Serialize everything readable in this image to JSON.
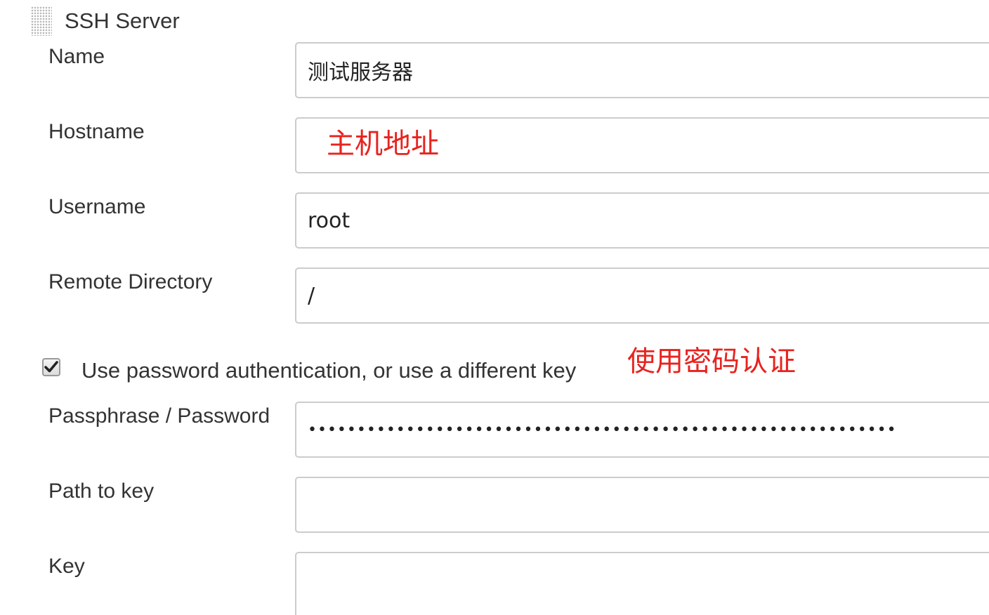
{
  "section": {
    "title": "SSH Server"
  },
  "fields": {
    "name": {
      "label": "Name",
      "value": "测试服务器"
    },
    "hostname": {
      "label": "Hostname",
      "value": "",
      "annotation": "主机地址"
    },
    "username": {
      "label": "Username",
      "value": "root"
    },
    "remote_directory": {
      "label": "Remote Directory",
      "value": "/"
    },
    "use_password": {
      "label": "Use password authentication, or use a different key",
      "checked": true,
      "annotation": "使用密码认证"
    },
    "passphrase": {
      "label": "Passphrase / Password",
      "value": "••••••••••••••••••••••••••••••••••••••••••••••••••••••••••••"
    },
    "path_to_key": {
      "label": "Path to key",
      "value": ""
    },
    "key": {
      "label": "Key",
      "value": ""
    }
  },
  "colors": {
    "annotation": "#e8231f",
    "border": "#cccccc",
    "text": "#333333"
  }
}
